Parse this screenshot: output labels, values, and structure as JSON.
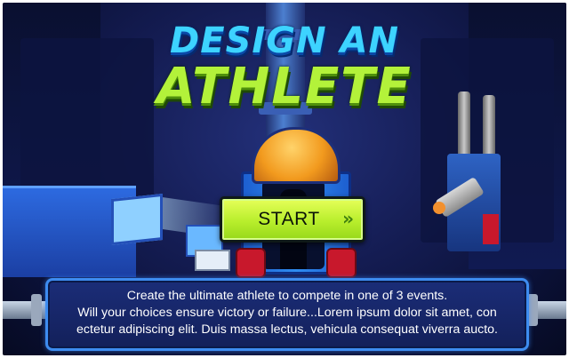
{
  "title": {
    "line1": "DESIGN AN",
    "line2": "ATHLETE"
  },
  "start_button": {
    "label": "START",
    "arrow": "»",
    "icon": "double-chevron-right-icon"
  },
  "description": {
    "lines": [
      "Create the ultimate athlete to compete in one of 3 events.",
      "Will your choices ensure victory or failure...Lorem ipsum dolor sit amet, con",
      "ectetur adipiscing elit. Duis massa lectus, vehicula consequat viverra aucto."
    ]
  },
  "colors": {
    "title_blue": "#3dd3ff",
    "title_green": "#b3f23a",
    "button_green": "#b8ee2c",
    "panel_border": "#3d8cf0",
    "background": "#141c52"
  }
}
